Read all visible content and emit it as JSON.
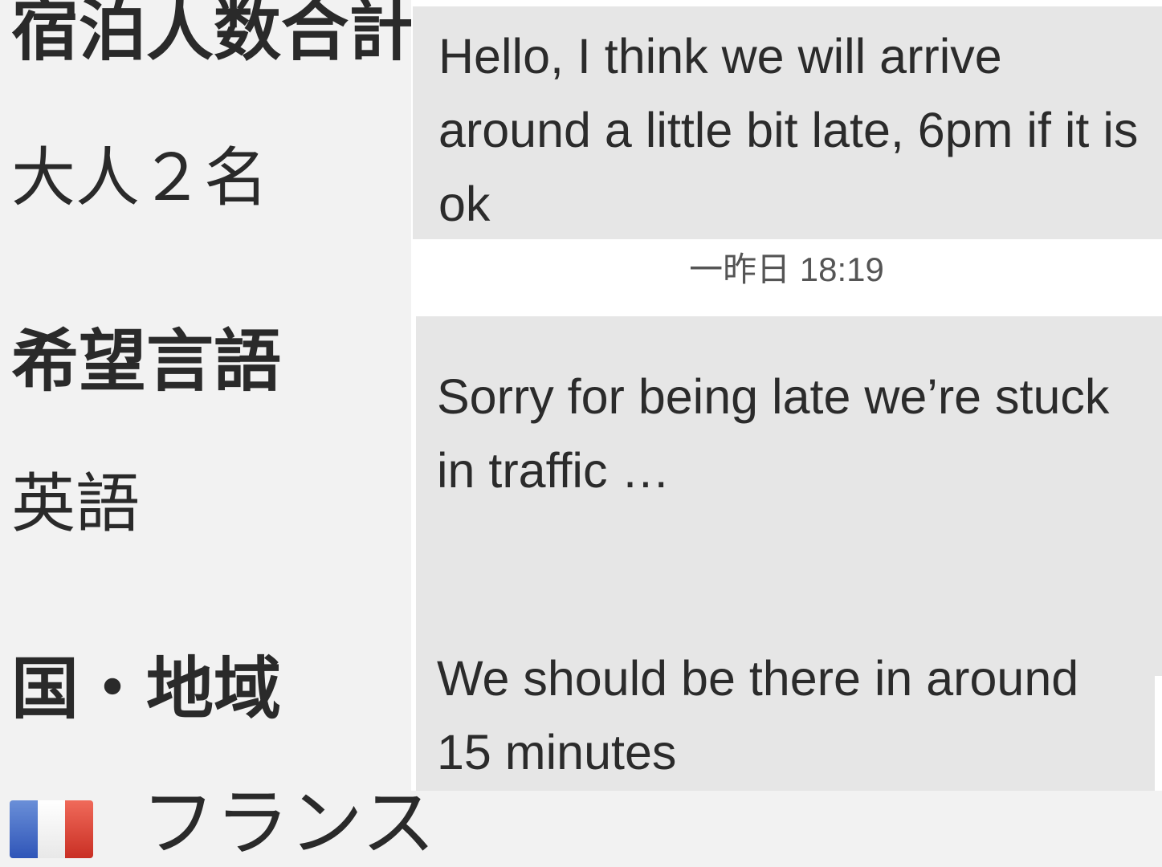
{
  "info": {
    "guests_heading": "宿泊人数合計",
    "guests_value": "大人２名",
    "language_heading": "希望言語",
    "language_value": "英語",
    "country_heading": "国・地域",
    "country_value": "フランス",
    "country_flag_icon": "france-flag-icon"
  },
  "chat": {
    "messages": [
      {
        "text": "Hello, I think we will arrive around a little bit late, 6pm if it is ok"
      },
      {
        "text": "Sorry for being late we’re stuck in traffic …"
      },
      {
        "text": "We should be there in around 15 minutes"
      }
    ],
    "timestamp": "一昨日 18:19"
  },
  "colors": {
    "bubble": "#e6e6e6",
    "panel_background": "#f2f2f2",
    "chat_background": "#ffffff",
    "text": "#2a2a2a",
    "flag_blue": "#2f55b8",
    "flag_white": "#ffffff",
    "flag_red": "#c92f24"
  }
}
